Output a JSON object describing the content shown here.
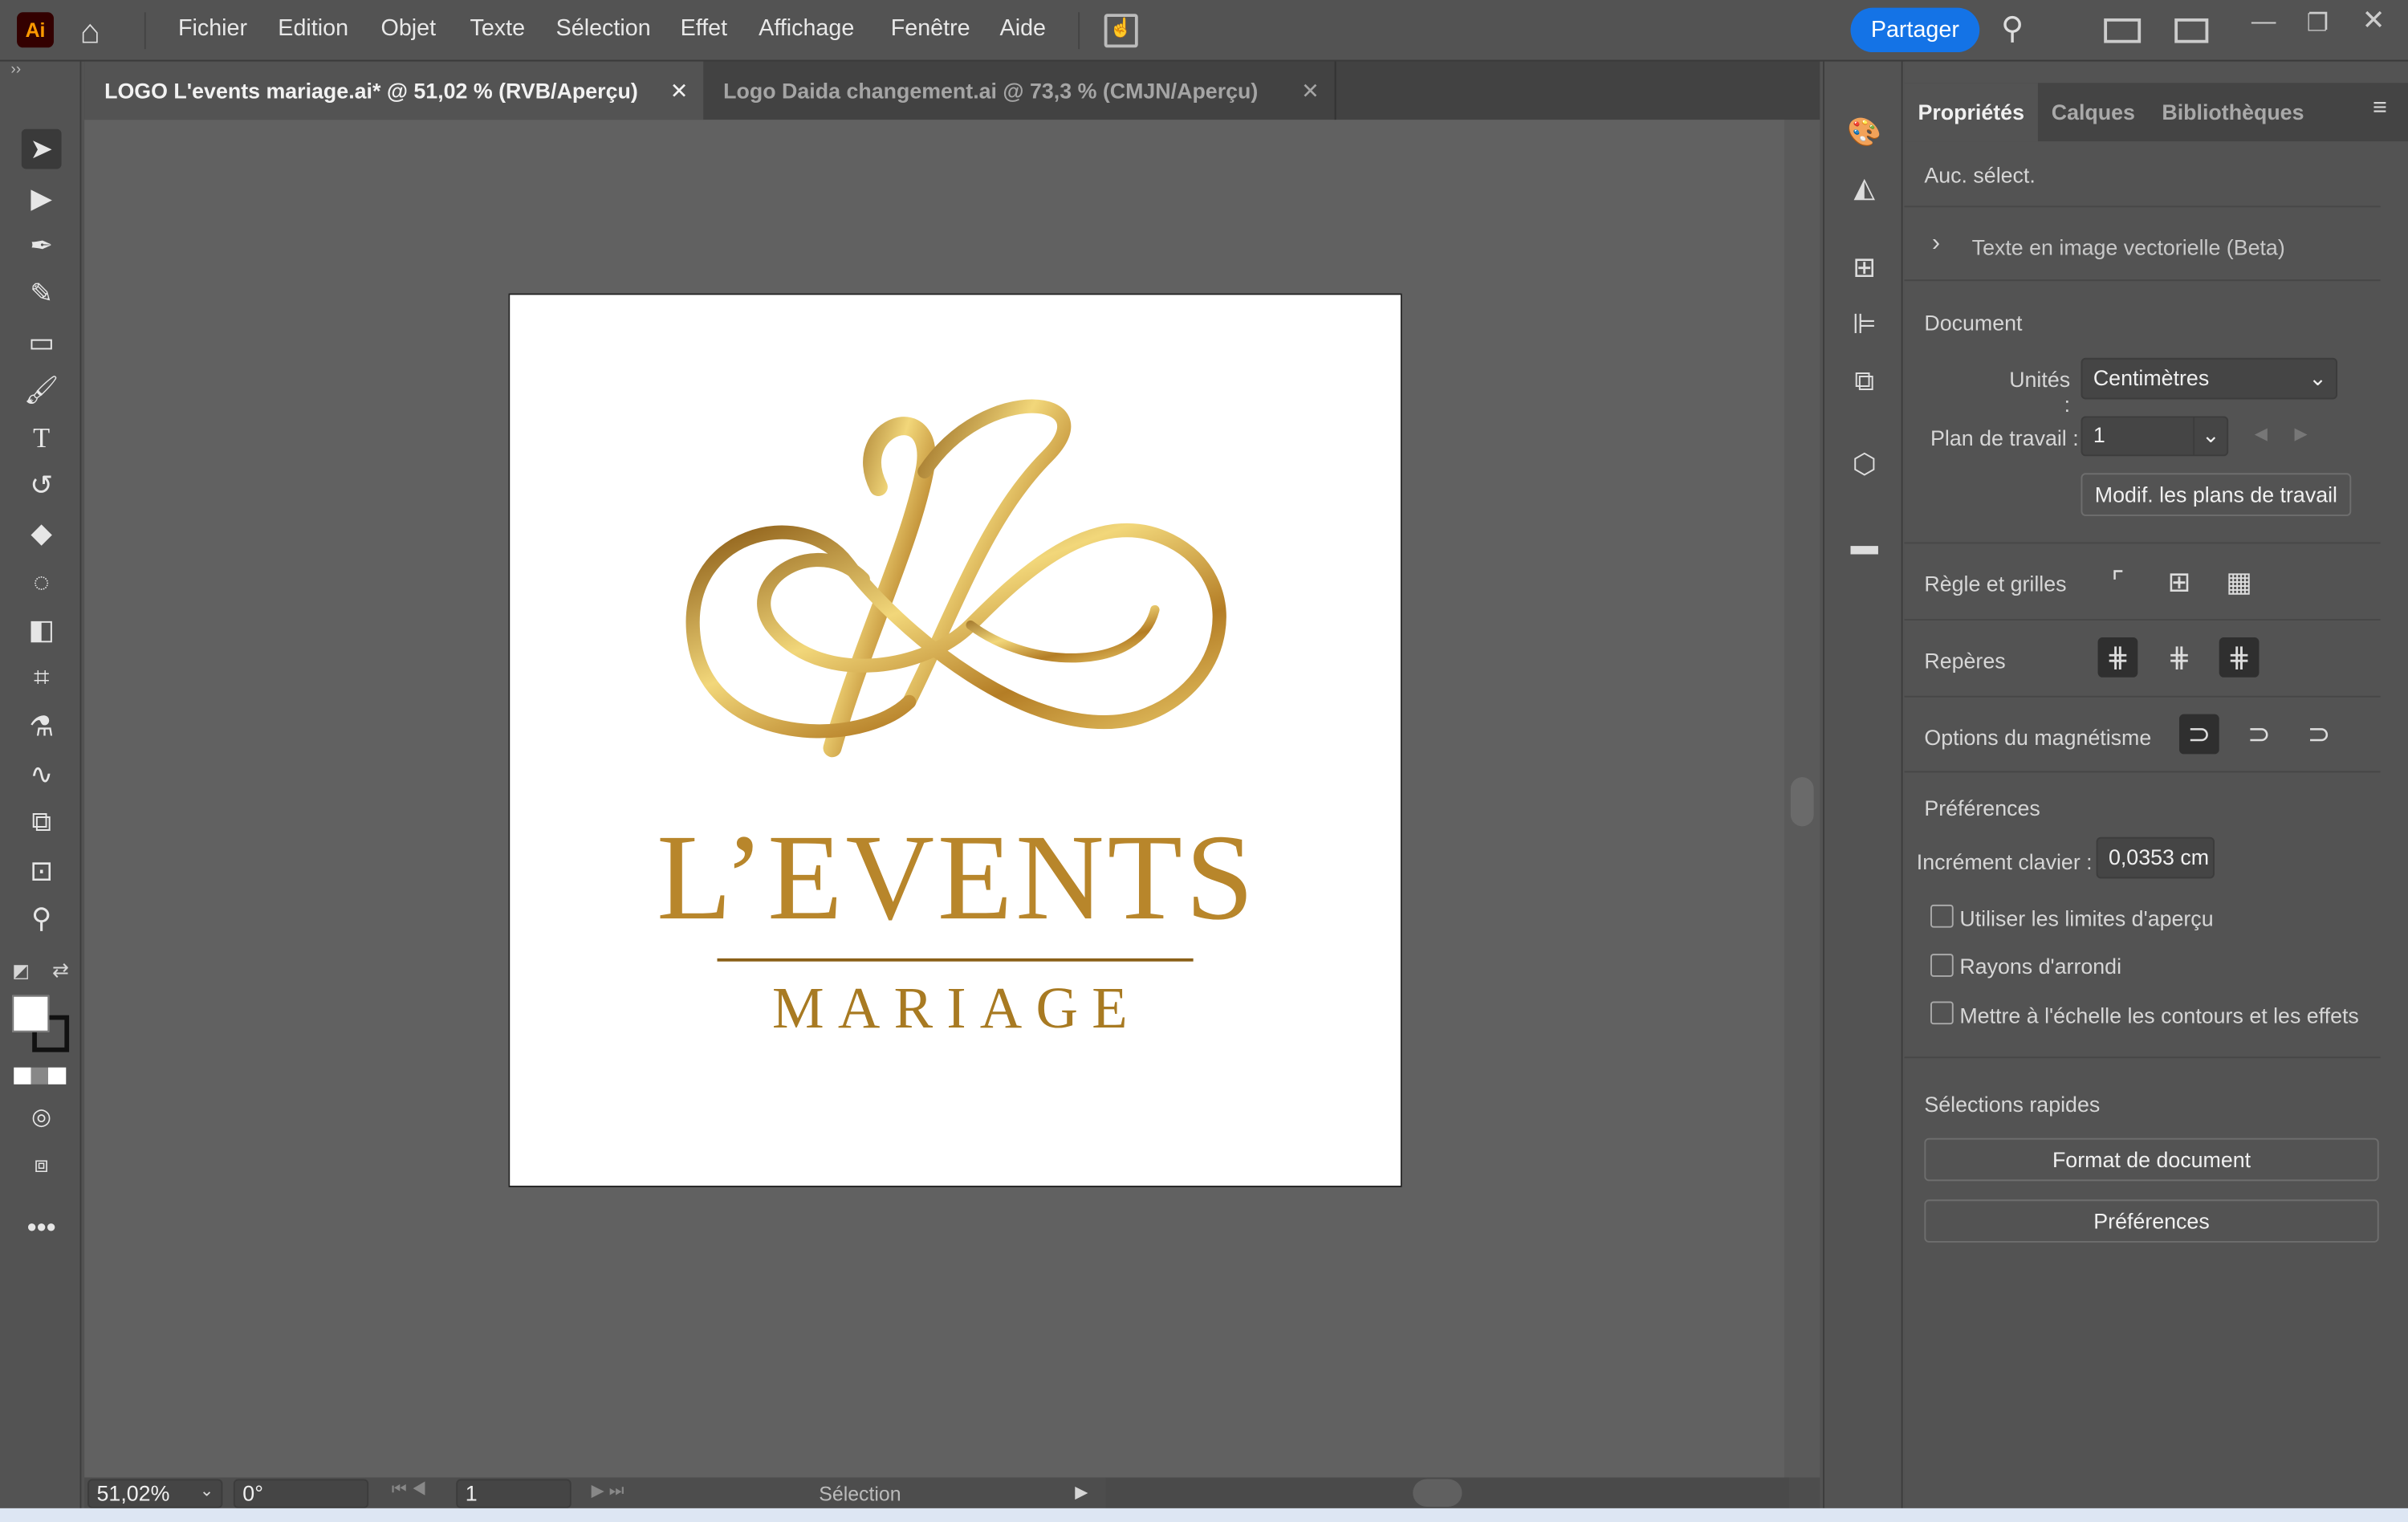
{
  "app": {
    "logo": "Ai",
    "menu": [
      "Fichier",
      "Edition",
      "Objet",
      "Texte",
      "Sélection",
      "Effet",
      "Affichage",
      "Fenêtre",
      "Aide"
    ],
    "share": "Partager",
    "accent": "#1473e6"
  },
  "tabs": [
    {
      "label": "LOGO L'events mariage.ai* @ 51,02 % (RVB/Aperçu)",
      "active": true
    },
    {
      "label": "Logo Daida changement.ai @ 73,3 % (CMJN/Aperçu)",
      "active": false
    }
  ],
  "artwork": {
    "title": "L’EVENTS",
    "subtitle": "MARIAGE",
    "gold": "#b8862b"
  },
  "status": {
    "zoom": "51,02%",
    "rotation": "0°",
    "artboard": "1",
    "tool": "Sélection"
  },
  "panel": {
    "tabs": [
      "Propriétés",
      "Calques",
      "Bibliothèques"
    ],
    "no_selection": "Auc. sélect.",
    "text_to_vector": "Texte en image vectorielle (Beta)",
    "document": "Document",
    "units_label": "Unités :",
    "units_value": "Centimètres",
    "artboard_label": "Plan de travail :",
    "artboard_value": "1",
    "edit_artboards": "Modif. les plans de travail",
    "rulers": "Règle et grilles",
    "guides": "Repères",
    "snap": "Options du magnétisme",
    "prefs": "Préférences",
    "increment_label": "Incrément clavier :",
    "increment_value": "0,0353 cm",
    "checkboxes": [
      {
        "label": "Utiliser les limites d'aperçu",
        "checked": false
      },
      {
        "label": "Rayons d'arrondi",
        "checked": false
      },
      {
        "label": "Mettre à l'échelle les contours et les effets",
        "checked": false
      }
    ],
    "quick": "Sélections rapides",
    "doc_setup": "Format de document",
    "prefs_button": "Préférences"
  }
}
